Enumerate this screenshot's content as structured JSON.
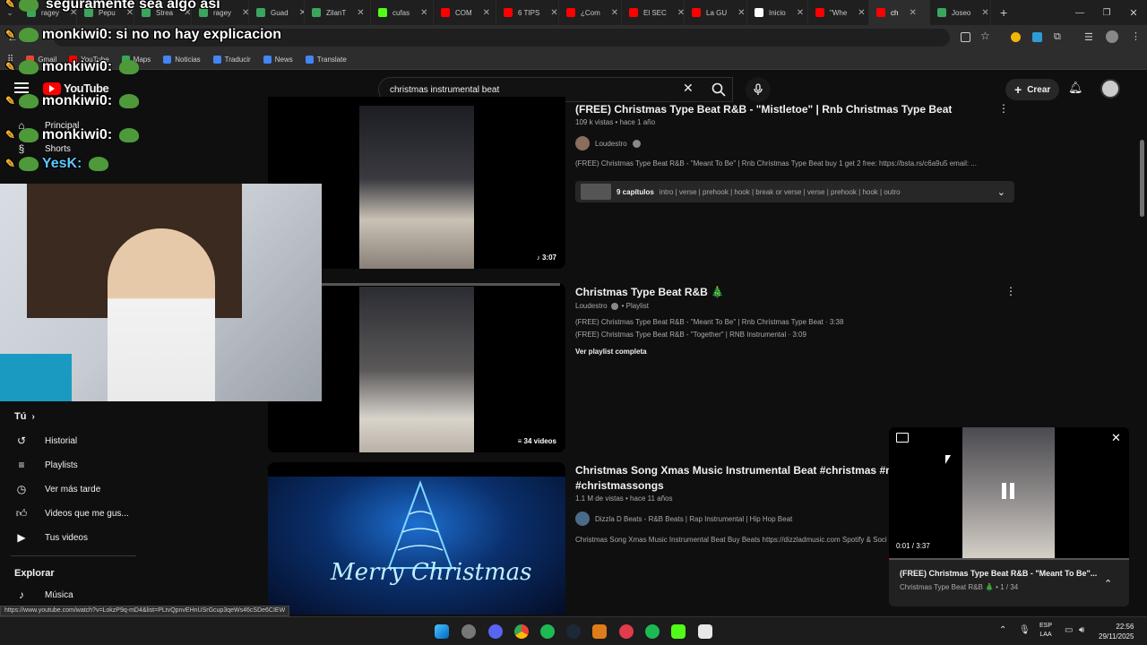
{
  "browser": {
    "tabs": [
      {
        "label": "ragey",
        "color": "#3ba55d"
      },
      {
        "label": "Pepu",
        "color": "#3ba55d"
      },
      {
        "label": "Strea",
        "color": "#3ba55d"
      },
      {
        "label": "ragey",
        "color": "#3ba55d"
      },
      {
        "label": "Guad",
        "color": "#3ba55d"
      },
      {
        "label": "ZilanT",
        "color": "#3ba55d"
      },
      {
        "label": "cufas",
        "color": "#53fc18"
      },
      {
        "label": "COM",
        "color": "#ff0000"
      },
      {
        "label": "6 TIPS",
        "color": "#ff0000"
      },
      {
        "label": "¿Com",
        "color": "#ff0000"
      },
      {
        "label": "El SEC",
        "color": "#ff0000"
      },
      {
        "label": "La GU",
        "color": "#ff0000"
      },
      {
        "label": "Inicio",
        "color": "#ffffff"
      },
      {
        "label": "\"Whe",
        "color": "#ff0000"
      },
      {
        "label": "ch",
        "color": "#ff0000"
      },
      {
        "label": "Joseo",
        "color": "#3ba55d"
      }
    ],
    "new_tab": "+",
    "bookmarks": [
      {
        "label": "Gmail",
        "color": "#ea4335"
      },
      {
        "label": "YouTube",
        "color": "#ff0000"
      },
      {
        "label": "Maps",
        "color": "#34a853"
      },
      {
        "label": "Noticias",
        "color": "#4285f4"
      },
      {
        "label": "Traducir",
        "color": "#4285f4"
      },
      {
        "label": "News",
        "color": "#4285f4"
      },
      {
        "label": "Translate",
        "color": "#4285f4"
      }
    ]
  },
  "stream_overlay": {
    "chat": [
      {
        "user": "",
        "msg": "seguramente sea algo asi"
      },
      {
        "user": "monkiwi0:",
        "msg": "si no no hay explicacion"
      },
      {
        "user": "monkiwi0:",
        "msg": ""
      },
      {
        "user": "monkiwi0:",
        "msg": ""
      },
      {
        "user": "monkiwi0:",
        "msg": ""
      },
      {
        "user": "YesK:",
        "msg": ""
      }
    ]
  },
  "youtube": {
    "logo": "YouTube",
    "search_query": "christmas instrumental beat",
    "create_label": "Crear",
    "sidebar": {
      "top": [
        {
          "label": "Principal",
          "icon": "home-icon"
        },
        {
          "label": "Shorts",
          "icon": "shorts-icon"
        }
      ],
      "you_header": "Tú",
      "you_items": [
        {
          "label": "Historial",
          "icon": "history-icon"
        },
        {
          "label": "Playlists",
          "icon": "playlist-icon"
        },
        {
          "label": "Ver más tarde",
          "icon": "clock-icon"
        },
        {
          "label": "Videos que me gus...",
          "icon": "like-icon"
        },
        {
          "label": "Tus videos",
          "icon": "video-icon"
        }
      ],
      "explore_header": "Explorar",
      "explore_items": [
        {
          "label": "Música",
          "icon": "music-icon"
        }
      ]
    },
    "results": [
      {
        "title": "(FREE) Christmas Type Beat R&B - \"Mistletoe\" | Rnb Christmas Type Beat",
        "meta": "109 k vistas • hace 1 año",
        "channel": "Loudestro",
        "description": "(FREE) Christmas Type Beat R&B - \"Meant To Be\" | Rnb Christmas Type Beat buy 1 get 2 free: https://bsta.rs/c6a9u5 email: ...",
        "chapters_count": "9 capítulos",
        "chapters": "intro | verse | prehook | hook | break or verse | verse | prehook | hook | outro",
        "duration": "3:07"
      },
      {
        "title": "Christmas Type Beat R&B 🎄",
        "channel": "Loudestro",
        "channel_suffix": "• Playlist",
        "items": [
          "(FREE) Christmas Type Beat R&B - \"Meant To Be\" | Rnb Christmas Type Beat · 3:38",
          "(FREE) Christmas Type Beat R&B - \"Together\" | RNB Instrumental · 3:09"
        ],
        "view_full": "Ver playlist completa",
        "count_badge": "34 videos"
      },
      {
        "title_line1": "Christmas Song Xmas Music Instrumental Beat #christmas #mus",
        "title_line2": "#christmassongs",
        "meta": "1.1 M de vistas • hace 11 años",
        "channel": "Dizzla D Beats - R&B Beats | Rap Instrumental | Hip Hop Beat",
        "description": "Christmas Song Xmas Music Instrumental Beat Buy Beats https://dizzladmusic.com Spotify & Soci",
        "thumb_text": "Merry Christmas"
      }
    ],
    "miniplayer": {
      "time": "0:01 / 3:37",
      "title": "(FREE) Christmas Type Beat R&B - \"Meant To Be\"...",
      "subtitle": "Christmas Type Beat R&B 🎄 • 1 / 34",
      "progress": 0.005
    },
    "status_url": "https://www.youtube.com/watch?v=LokzP9q-mD4&list=PLtvQpnvEHnUSrGcup3qeWs46cSDe6CIEW"
  },
  "taskbar": {
    "lang1": "ESP",
    "lang2": "LAA",
    "time": "22:56",
    "date": "29/11/2025"
  }
}
